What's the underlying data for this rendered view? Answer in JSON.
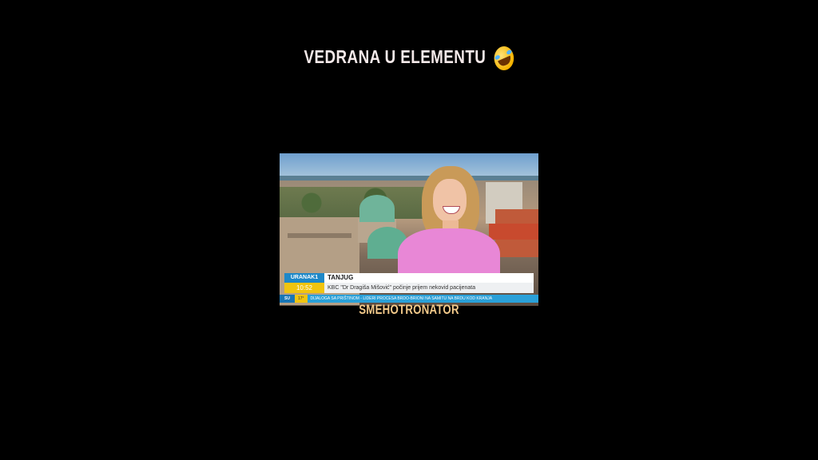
{
  "caption": {
    "text": "VEDRANA U ELEMENTU",
    "emoji": "rolling-on-floor-laughing-emoji"
  },
  "video": {
    "lower_third": {
      "brand": "URANAK1",
      "time": "10:52",
      "source": "TANJUG",
      "headline": "KBC \"Dr Dragiša Mišović\" počinje prijem nekovid pacijenata"
    },
    "ticker": {
      "day": "SU",
      "temp": "17°",
      "text": "DIJALOGA SA PRIŠTINOM - LIDERI PROCESA BRDO-BRIONI NA SAMITU NA BRDU KOD KRANJA"
    }
  },
  "watermark": "SMEHOTRONATOR"
}
